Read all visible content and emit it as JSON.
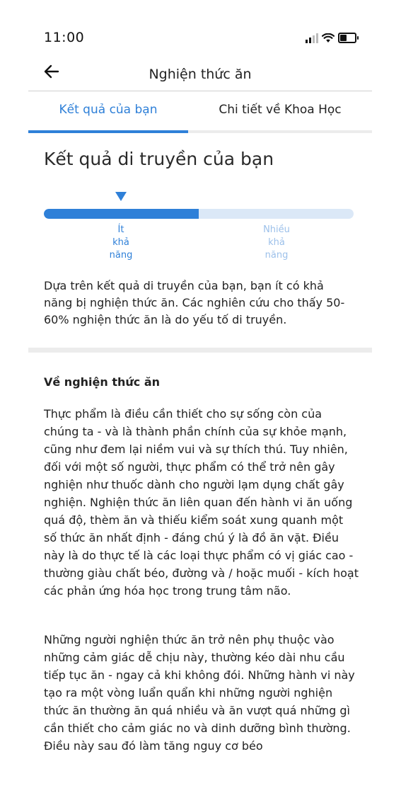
{
  "status": {
    "time": "11:00"
  },
  "header": {
    "title": "Nghiện thức ăn"
  },
  "tabs": [
    {
      "label": "Kết quả của bạn"
    },
    {
      "label": "Chi tiết về Khoa Học"
    }
  ],
  "result": {
    "heading": "Kết quả di truyền của bạn",
    "level_fraction": 0.5,
    "low_label": "Ít\nkhả\nnăng",
    "high_label": "Nhiều\nkhả\nnăng",
    "summary": "Dựa trên kết quả di truyền của bạn, bạn ít có khả năng bị nghiện thức ăn. Các nghiên cứu cho thấy 50-60% nghiện thức ăn là do yếu tố di truyền."
  },
  "about": {
    "heading": "Về nghiện thức ăn",
    "paragraphs": [
      "Thực phẩm là điều cần thiết cho sự sống còn của chúng ta - và là thành phần chính của sự khỏe mạnh, cũng như đem lại niềm vui và sự thích thú. Tuy nhiên, đối với một số người, thực phẩm có thể trở nên gây nghiện như thuốc dành cho người lạm dụng chất gây nghiện. Nghiện thức ăn liên quan đến hành vi ăn uống quá độ, thèm ăn và thiếu kiểm soát xung quanh một số thức ăn nhất định - đáng chú ý là đồ ăn vặt. Điều này là do thực tế là các loại thực phẩm có vị giác cao - thường giàu chất béo, đường và / hoặc muối - kích hoạt các phản ứng hóa học trong trung tâm não.",
      "Những người nghiện thức ăn trở nên phụ thuộc vào những cảm giác dễ chịu này, thường kéo dài nhu cầu tiếp tục ăn - ngay cả khi không đói. Những hành vi này tạo ra một vòng luẩn quẩn khi những người nghiện thức ăn thường ăn quá nhiều và ăn vượt quá những gì cần thiết cho cảm giác no và dinh dưỡng bình thường. Điều này sau đó làm tăng nguy cơ béo"
    ]
  },
  "colors": {
    "accent": "#2f80d8",
    "track": "#dbe8f7",
    "muted_label": "#9cc0ea"
  },
  "icons": {
    "back": "arrow-left-icon",
    "signal": "cellular-signal-icon",
    "wifi": "wifi-icon",
    "battery": "battery-icon"
  }
}
